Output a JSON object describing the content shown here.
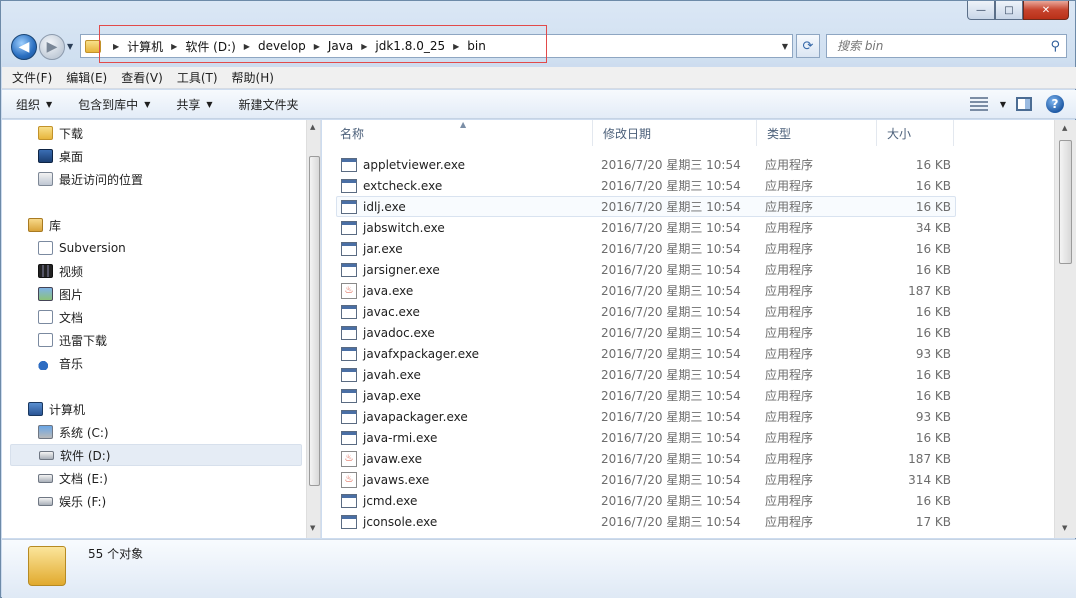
{
  "window": {
    "caption": {
      "minimize": "—",
      "maximize": "□",
      "close": "✕"
    }
  },
  "address": {
    "crumbs": [
      "计算机",
      "软件 (D:)",
      "develop",
      "Java",
      "jdk1.8.0_25",
      "bin"
    ],
    "search_placeholder": "搜索 bin"
  },
  "menu": [
    "文件(F)",
    "编辑(E)",
    "查看(V)",
    "工具(T)",
    "帮助(H)"
  ],
  "commands": {
    "organize": "组织",
    "include": "包含到库中",
    "share": "共享",
    "new_folder": "新建文件夹"
  },
  "nav": {
    "favorites": [
      {
        "label": "下载",
        "icon": "download-folder-icon"
      },
      {
        "label": "桌面",
        "icon": "desktop-icon"
      },
      {
        "label": "最近访问的位置",
        "icon": "recent-places-icon"
      }
    ],
    "libraries_label": "库",
    "libraries": [
      {
        "label": "Subversion",
        "icon": "document-icon"
      },
      {
        "label": "视频",
        "icon": "video-icon"
      },
      {
        "label": "图片",
        "icon": "picture-icon"
      },
      {
        "label": "文档",
        "icon": "document-icon"
      },
      {
        "label": "迅雷下载",
        "icon": "document-icon"
      },
      {
        "label": "音乐",
        "icon": "music-icon"
      }
    ],
    "computer_label": "计算机",
    "drives": [
      {
        "label": "系统 (C:)",
        "icon": "system-drive-icon"
      },
      {
        "label": "软件 (D:)",
        "icon": "drive-icon",
        "selected": true
      },
      {
        "label": "文档 (E:)",
        "icon": "drive-icon"
      },
      {
        "label": "娱乐 (F:)",
        "icon": "drive-icon"
      }
    ]
  },
  "columns": {
    "name": "名称",
    "date": "修改日期",
    "type": "类型",
    "size": "大小"
  },
  "files": [
    {
      "name": "appletviewer.exe",
      "date": "2016/7/20 星期三 10:54",
      "type": "应用程序",
      "size": "16 KB",
      "icon": "exe"
    },
    {
      "name": "extcheck.exe",
      "date": "2016/7/20 星期三 10:54",
      "type": "应用程序",
      "size": "16 KB",
      "icon": "exe"
    },
    {
      "name": "idlj.exe",
      "date": "2016/7/20 星期三 10:54",
      "type": "应用程序",
      "size": "16 KB",
      "icon": "exe",
      "hover": true
    },
    {
      "name": "jabswitch.exe",
      "date": "2016/7/20 星期三 10:54",
      "type": "应用程序",
      "size": "34 KB",
      "icon": "exe"
    },
    {
      "name": "jar.exe",
      "date": "2016/7/20 星期三 10:54",
      "type": "应用程序",
      "size": "16 KB",
      "icon": "exe"
    },
    {
      "name": "jarsigner.exe",
      "date": "2016/7/20 星期三 10:54",
      "type": "应用程序",
      "size": "16 KB",
      "icon": "exe"
    },
    {
      "name": "java.exe",
      "date": "2016/7/20 星期三 10:54",
      "type": "应用程序",
      "size": "187 KB",
      "icon": "java"
    },
    {
      "name": "javac.exe",
      "date": "2016/7/20 星期三 10:54",
      "type": "应用程序",
      "size": "16 KB",
      "icon": "exe"
    },
    {
      "name": "javadoc.exe",
      "date": "2016/7/20 星期三 10:54",
      "type": "应用程序",
      "size": "16 KB",
      "icon": "exe"
    },
    {
      "name": "javafxpackager.exe",
      "date": "2016/7/20 星期三 10:54",
      "type": "应用程序",
      "size": "93 KB",
      "icon": "exe"
    },
    {
      "name": "javah.exe",
      "date": "2016/7/20 星期三 10:54",
      "type": "应用程序",
      "size": "16 KB",
      "icon": "exe"
    },
    {
      "name": "javap.exe",
      "date": "2016/7/20 星期三 10:54",
      "type": "应用程序",
      "size": "16 KB",
      "icon": "exe"
    },
    {
      "name": "javapackager.exe",
      "date": "2016/7/20 星期三 10:54",
      "type": "应用程序",
      "size": "93 KB",
      "icon": "exe"
    },
    {
      "name": "java-rmi.exe",
      "date": "2016/7/20 星期三 10:54",
      "type": "应用程序",
      "size": "16 KB",
      "icon": "exe"
    },
    {
      "name": "javaw.exe",
      "date": "2016/7/20 星期三 10:54",
      "type": "应用程序",
      "size": "187 KB",
      "icon": "java"
    },
    {
      "name": "javaws.exe",
      "date": "2016/7/20 星期三 10:54",
      "type": "应用程序",
      "size": "314 KB",
      "icon": "java"
    },
    {
      "name": "jcmd.exe",
      "date": "2016/7/20 星期三 10:54",
      "type": "应用程序",
      "size": "16 KB",
      "icon": "exe"
    },
    {
      "name": "jconsole.exe",
      "date": "2016/7/20 星期三 10:54",
      "type": "应用程序",
      "size": "17 KB",
      "icon": "exe"
    }
  ],
  "details": {
    "count_text": "55 个对象"
  }
}
